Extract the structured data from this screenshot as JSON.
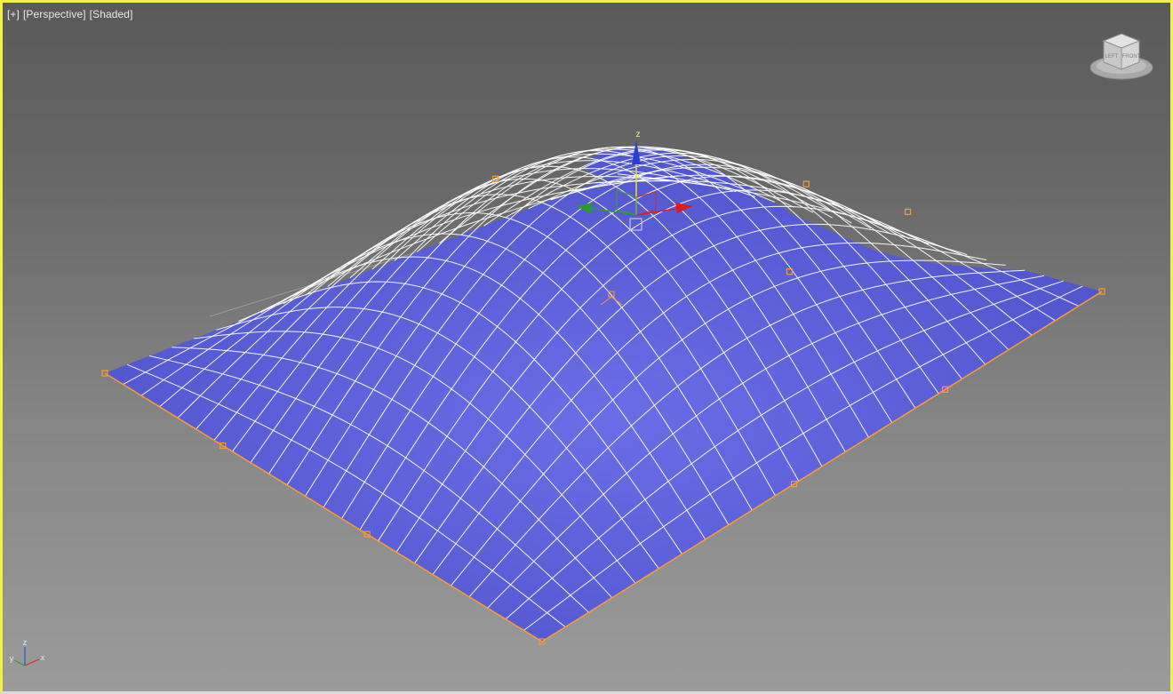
{
  "viewport": {
    "plus_label": "[+]",
    "view_label": "[Perspective]",
    "shading_label": "[Shaded]",
    "border_color": "#f3f04a",
    "surface_color": "#5b5fd8",
    "selection_color": "#ff9a30",
    "wire_color": "#ffffff"
  },
  "gizmo": {
    "z_label": "z",
    "x_color": "#d62020",
    "y_color": "#2a9a2a",
    "z_color": "#2840d0",
    "handle_color": "#e8e020"
  },
  "viewcube": {
    "left_face": "LEFT",
    "front_face": "FRONT"
  },
  "axis_tripod": {
    "z": "z",
    "y": "y",
    "x": "x"
  }
}
